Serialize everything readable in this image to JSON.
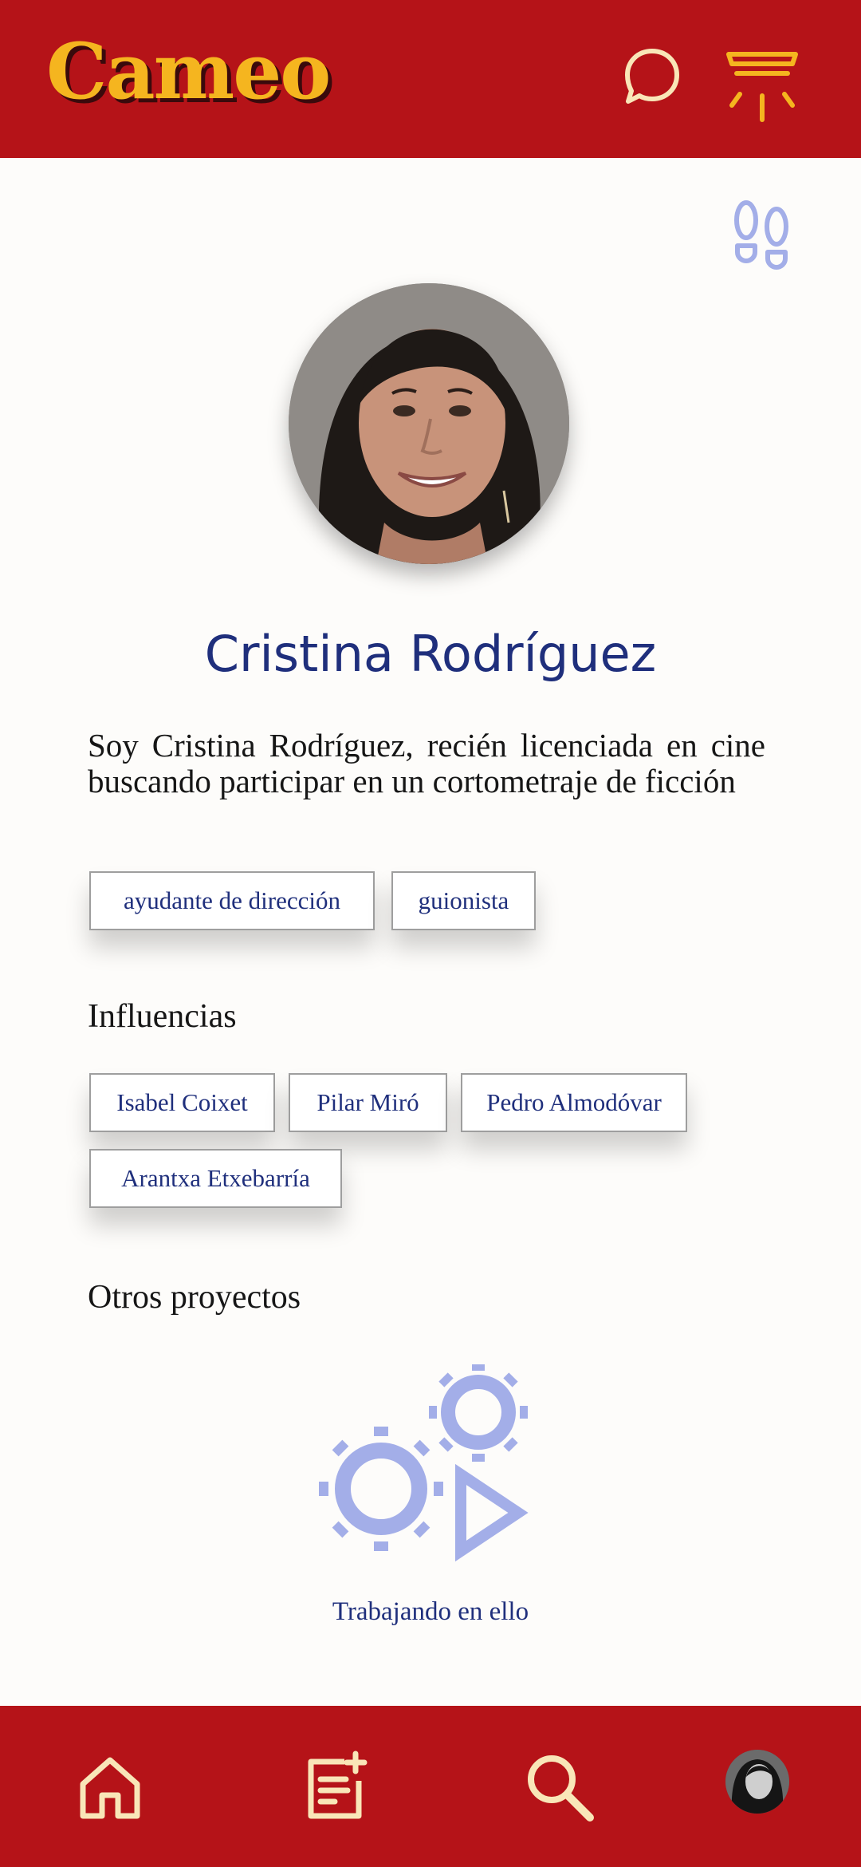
{
  "app": {
    "title": "Cameo"
  },
  "profile": {
    "name": "Cristina Rodríguez",
    "bio": "Soy Cristina Rodríguez, recién licenciada en cine buscando participar en un cortometraje de ficción",
    "roles": [
      "ayudante de dirección",
      "guionista"
    ],
    "influences_title": "Influencias",
    "influences": [
      "Isabel Coixet",
      "Pilar Miró",
      "Pedro Almodóvar",
      "Arantxa Etxebarría"
    ],
    "projects_title": "Otros proyectos",
    "projects_empty_label": "Trabajando en ello"
  },
  "icons": {
    "messages": "speech-bubble-icon",
    "spotlight": "spotlight-icon",
    "footsteps": "footsteps-icon",
    "projects_placeholder": "gears-play-icon",
    "nav_home": "home-icon",
    "nav_add": "add-note-icon",
    "nav_search": "search-icon",
    "nav_profile": "profile-avatar"
  },
  "colors": {
    "brand_red": "#B51318",
    "accent_yellow": "#F5B51F",
    "text_blue": "#1F2F7C",
    "icon_lilac": "#A3AEE8",
    "nav_cream": "#F9E6B8"
  }
}
